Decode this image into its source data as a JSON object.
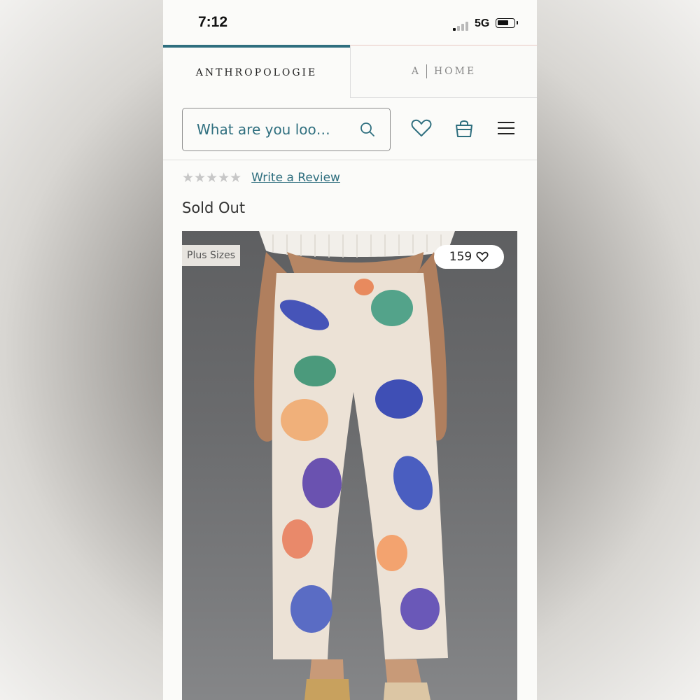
{
  "status_bar": {
    "time": "7:12",
    "network": "5G"
  },
  "tabs": {
    "brand": "ANTHROPOLOGIE",
    "home_a": "A",
    "home_label": "HOME"
  },
  "search": {
    "placeholder": "What are you loo…"
  },
  "rating": {
    "stars": "★★★★★",
    "review_link": "Write a Review"
  },
  "product": {
    "availability": "Sold Out",
    "badge": "Plus Sizes",
    "likes": "159"
  },
  "colors": {
    "accent": "#2f6f7f",
    "star_empty": "#c7c7c7"
  },
  "icons": [
    "search-icon",
    "heart-icon",
    "bag-icon",
    "menu-icon",
    "heart-outline-icon"
  ]
}
